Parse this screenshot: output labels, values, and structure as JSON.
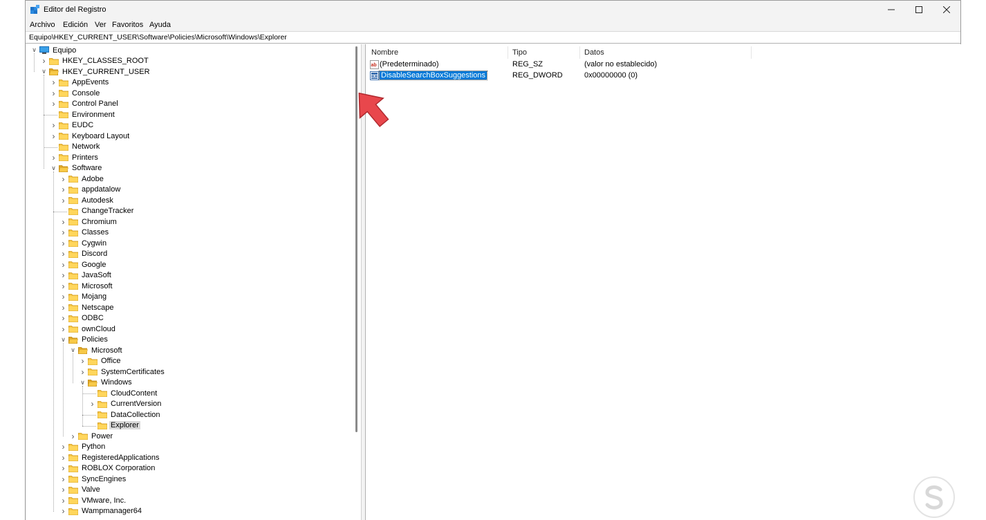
{
  "window": {
    "title": "Editor del Registro"
  },
  "menu": [
    "Archivo",
    "Edición",
    "Ver",
    "Favoritos",
    "Ayuda"
  ],
  "address": "Equipo\\HKEY_CURRENT_USER\\Software\\Policies\\Microsoft\\Windows\\Explorer",
  "tree": [
    {
      "label": "Equipo",
      "depth": 0,
      "state": "open",
      "icon": "computer-icon"
    },
    {
      "label": "HKEY_CLASSES_ROOT",
      "depth": 1,
      "state": "closed"
    },
    {
      "label": "HKEY_CURRENT_USER",
      "depth": 1,
      "state": "open"
    },
    {
      "label": "AppEvents",
      "depth": 2,
      "state": "closed"
    },
    {
      "label": "Console",
      "depth": 2,
      "state": "closed"
    },
    {
      "label": "Control Panel",
      "depth": 2,
      "state": "closed"
    },
    {
      "label": "Environment",
      "depth": 2,
      "state": "leaf"
    },
    {
      "label": "EUDC",
      "depth": 2,
      "state": "closed"
    },
    {
      "label": "Keyboard Layout",
      "depth": 2,
      "state": "closed"
    },
    {
      "label": "Network",
      "depth": 2,
      "state": "leaf"
    },
    {
      "label": "Printers",
      "depth": 2,
      "state": "closed"
    },
    {
      "label": "Software",
      "depth": 2,
      "state": "open"
    },
    {
      "label": "Adobe",
      "depth": 3,
      "state": "closed"
    },
    {
      "label": "appdatalow",
      "depth": 3,
      "state": "closed"
    },
    {
      "label": "Autodesk",
      "depth": 3,
      "state": "closed"
    },
    {
      "label": "ChangeTracker",
      "depth": 3,
      "state": "leaf"
    },
    {
      "label": "Chromium",
      "depth": 3,
      "state": "closed"
    },
    {
      "label": "Classes",
      "depth": 3,
      "state": "closed"
    },
    {
      "label": "Cygwin",
      "depth": 3,
      "state": "closed"
    },
    {
      "label": "Discord",
      "depth": 3,
      "state": "closed"
    },
    {
      "label": "Google",
      "depth": 3,
      "state": "closed"
    },
    {
      "label": "JavaSoft",
      "depth": 3,
      "state": "closed"
    },
    {
      "label": "Microsoft",
      "depth": 3,
      "state": "closed"
    },
    {
      "label": "Mojang",
      "depth": 3,
      "state": "closed"
    },
    {
      "label": "Netscape",
      "depth": 3,
      "state": "closed"
    },
    {
      "label": "ODBC",
      "depth": 3,
      "state": "closed"
    },
    {
      "label": "ownCloud",
      "depth": 3,
      "state": "closed"
    },
    {
      "label": "Policies",
      "depth": 3,
      "state": "open"
    },
    {
      "label": "Microsoft",
      "depth": 4,
      "state": "open"
    },
    {
      "label": "Office",
      "depth": 5,
      "state": "closed"
    },
    {
      "label": "SystemCertificates",
      "depth": 5,
      "state": "closed"
    },
    {
      "label": "Windows",
      "depth": 5,
      "state": "open"
    },
    {
      "label": "CloudContent",
      "depth": 6,
      "state": "leaf"
    },
    {
      "label": "CurrentVersion",
      "depth": 6,
      "state": "closed"
    },
    {
      "label": "DataCollection",
      "depth": 6,
      "state": "leaf"
    },
    {
      "label": "Explorer",
      "depth": 6,
      "state": "leaf",
      "selected": true
    },
    {
      "label": "Power",
      "depth": 4,
      "state": "closed"
    },
    {
      "label": "Python",
      "depth": 3,
      "state": "closed"
    },
    {
      "label": "RegisteredApplications",
      "depth": 3,
      "state": "closed"
    },
    {
      "label": "ROBLOX Corporation",
      "depth": 3,
      "state": "closed"
    },
    {
      "label": "SyncEngines",
      "depth": 3,
      "state": "closed"
    },
    {
      "label": "Valve",
      "depth": 3,
      "state": "closed"
    },
    {
      "label": "VMware, Inc.",
      "depth": 3,
      "state": "closed"
    },
    {
      "label": "Wampmanager64",
      "depth": 3,
      "state": "closed"
    }
  ],
  "columns": [
    "Nombre",
    "Tipo",
    "Datos"
  ],
  "values": [
    {
      "name": "(Predeterminado)",
      "type": "REG_SZ",
      "data": "(valor no establecido)",
      "icon": "string-value-icon",
      "selected": false
    },
    {
      "name": "DisableSearchBoxSuggestions",
      "type": "REG_DWORD",
      "data": "0x00000000 (0)",
      "icon": "dword-value-icon",
      "selected": true
    }
  ],
  "colors": {
    "selection": "#0078d7",
    "arrow": "#e8474c",
    "folder": "#f7c948"
  }
}
